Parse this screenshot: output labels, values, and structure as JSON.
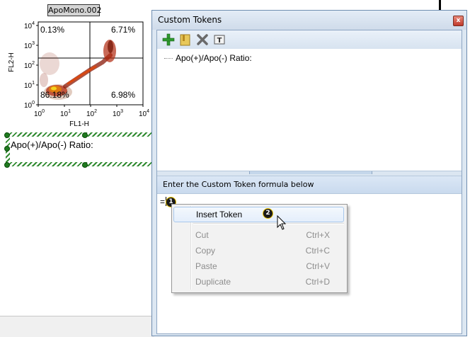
{
  "plot": {
    "title": "ApoMono.002",
    "ylabel": "FL2-H",
    "xlabel": "FL1-H",
    "quadrants": {
      "upper_left": "0.13%",
      "upper_right": "6.71%",
      "lower_left": "86.18%",
      "lower_right": "6.98%"
    },
    "y_ticks": [
      "10",
      "10",
      "10",
      "10",
      "10"
    ],
    "y_tick_exps": [
      "4",
      "3",
      "2",
      "1",
      "0"
    ],
    "x_ticks": [
      "10",
      "10",
      "10",
      "10",
      "10"
    ],
    "x_tick_exps": [
      "0",
      "1",
      "2",
      "3",
      "4"
    ]
  },
  "canvas": {
    "ratio_label": "Apo(+)/Apo(-) Ratio:"
  },
  "window": {
    "title": "Custom Tokens",
    "close_glyph": "x",
    "toolbar_icons": [
      "add-icon",
      "folder-icon",
      "delete-icon",
      "text-token-icon"
    ],
    "tree_items": [
      "Apo(+)/Apo(-) Ratio:"
    ],
    "prompt": "Enter the Custom Token formula below",
    "formula": "="
  },
  "badges": {
    "step1": "1",
    "step2": "2"
  },
  "context_menu": {
    "items": [
      {
        "label": "Insert Token",
        "shortcut": "",
        "enabled": true
      },
      {
        "label": "Cut",
        "shortcut": "Ctrl+X",
        "enabled": false
      },
      {
        "label": "Copy",
        "shortcut": "Ctrl+C",
        "enabled": false
      },
      {
        "label": "Paste",
        "shortcut": "Ctrl+V",
        "enabled": false
      },
      {
        "label": "Duplicate",
        "shortcut": "Ctrl+D",
        "enabled": false
      }
    ]
  }
}
